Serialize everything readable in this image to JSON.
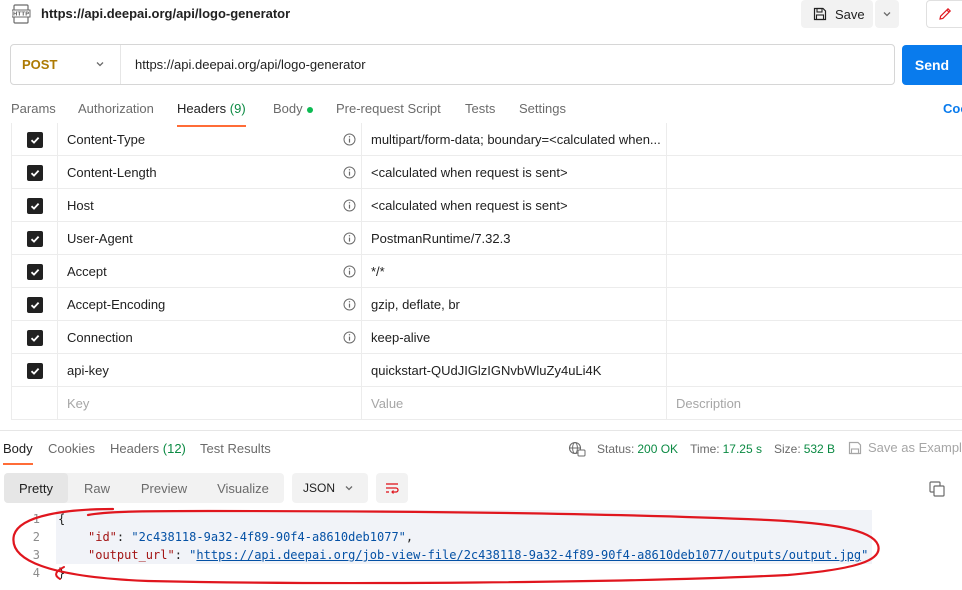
{
  "title_bar": {
    "title": "https://api.deepai.org/api/logo-generator",
    "save_label": "Save",
    "icons": [
      "http-file-icon",
      "save-icon",
      "chevron-down-icon",
      "pencil-icon"
    ]
  },
  "request": {
    "method": "POST",
    "url": "https://api.deepai.org/api/logo-generator",
    "send_label": "Send"
  },
  "request_tabs": {
    "params": "Params",
    "authorization": "Authorization",
    "headers": "Headers",
    "headers_count": "(9)",
    "body": "Body",
    "pre_request": "Pre-request Script",
    "tests": "Tests",
    "settings": "Settings",
    "cookies": "Coo"
  },
  "headers": [
    {
      "key": "Content-Type",
      "value": "multipart/form-data; boundary=<calculated when..."
    },
    {
      "key": "Content-Length",
      "value": "<calculated when request is sent>"
    },
    {
      "key": "Host",
      "value": "<calculated when request is sent>"
    },
    {
      "key": "User-Agent",
      "value": "PostmanRuntime/7.32.3"
    },
    {
      "key": "Accept",
      "value": "*/*"
    },
    {
      "key": "Accept-Encoding",
      "value": "gzip, deflate, br"
    },
    {
      "key": "Connection",
      "value": "keep-alive"
    },
    {
      "key": "api-key",
      "value": "quickstart-QUdJIGlzIGNvbWluZy4uLi4K"
    }
  ],
  "headers_placeholder": {
    "key": "Key",
    "value": "Value",
    "description": "Description"
  },
  "response_tabs": {
    "body": "Body",
    "cookies": "Cookies",
    "headers": "Headers",
    "headers_count": "(12)",
    "test_results": "Test Results"
  },
  "response_status": {
    "status_label": "Status:",
    "status_value": "200 OK",
    "time_label": "Time:",
    "time_value": "17.25 s",
    "size_label": "Size:",
    "size_value": "532 B",
    "save_example": "Save as Example"
  },
  "format_bar": {
    "pretty": "Pretty",
    "raw": "Raw",
    "preview": "Preview",
    "visualize": "Visualize",
    "format": "JSON"
  },
  "response_body": {
    "line_numbers": [
      "1",
      "2",
      "3",
      "4"
    ],
    "open_brace": "{",
    "close_brace": "}",
    "id_key": "\"id\"",
    "id_value": "\"2c438118-9a32-4f89-90f4-a8610deb1077\"",
    "output_key": "\"output_url\"",
    "output_value": "https://api.deepai.org/job-view-file/2c438118-9a32-4f89-90f4-a8610deb1077/outputs/output.jpg",
    "colon": ": ",
    "comma": ","
  },
  "colors": {
    "accent_orange": "#ff6c37",
    "send_blue": "#097bed",
    "method_post": "#ad7a03",
    "status_green": "#0b8a43",
    "annotation_red": "#e0161e"
  }
}
